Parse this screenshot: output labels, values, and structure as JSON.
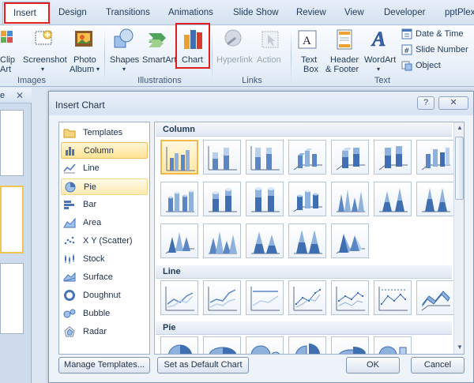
{
  "ribbon_tabs": {
    "insert": "Insert",
    "design": "Design",
    "transitions": "Transitions",
    "animations": "Animations",
    "slideshow": "Slide Show",
    "review": "Review",
    "view": "View",
    "developer": "Developer",
    "pptplex": "pptPlex"
  },
  "ribbon": {
    "clip_art_1": "Clip",
    "clip_art_2": "Art",
    "screenshot": "Screenshot",
    "photo_album_1": "Photo",
    "photo_album_2": "Album",
    "group_images": "Images",
    "shapes": "Shapes",
    "smartart": "SmartArt",
    "chart": "Chart",
    "group_illustrations": "Illustrations",
    "hyperlink": "Hyperlink",
    "action": "Action",
    "group_links": "Links",
    "text_box_1": "Text",
    "text_box_2": "Box",
    "header_footer_1": "Header",
    "header_footer_2": "& Footer",
    "wordart": "WordArt",
    "date_time": "Date & Time",
    "slide_number": "Slide Number",
    "object": "Object",
    "group_text": "Text"
  },
  "left_pane": {
    "tab_label": "e",
    "close_glyph": "✕"
  },
  "dialog": {
    "title": "Insert Chart",
    "help_glyph": "?",
    "close_glyph": "✕",
    "chart_types": [
      "Templates",
      "Column",
      "Line",
      "Pie",
      "Bar",
      "Area",
      "X Y (Scatter)",
      "Stock",
      "Surface",
      "Doughnut",
      "Bubble",
      "Radar"
    ],
    "sections": {
      "column": "Column",
      "line": "Line",
      "pie": "Pie"
    },
    "buttons": {
      "manage_templates": "Manage Templates...",
      "set_default": "Set as Default Chart",
      "ok": "OK",
      "cancel": "Cancel"
    }
  },
  "colors": {
    "highlight_red": "#e02020",
    "selection_gold": "#f2c552",
    "chart_blue": "#4a76b8"
  }
}
